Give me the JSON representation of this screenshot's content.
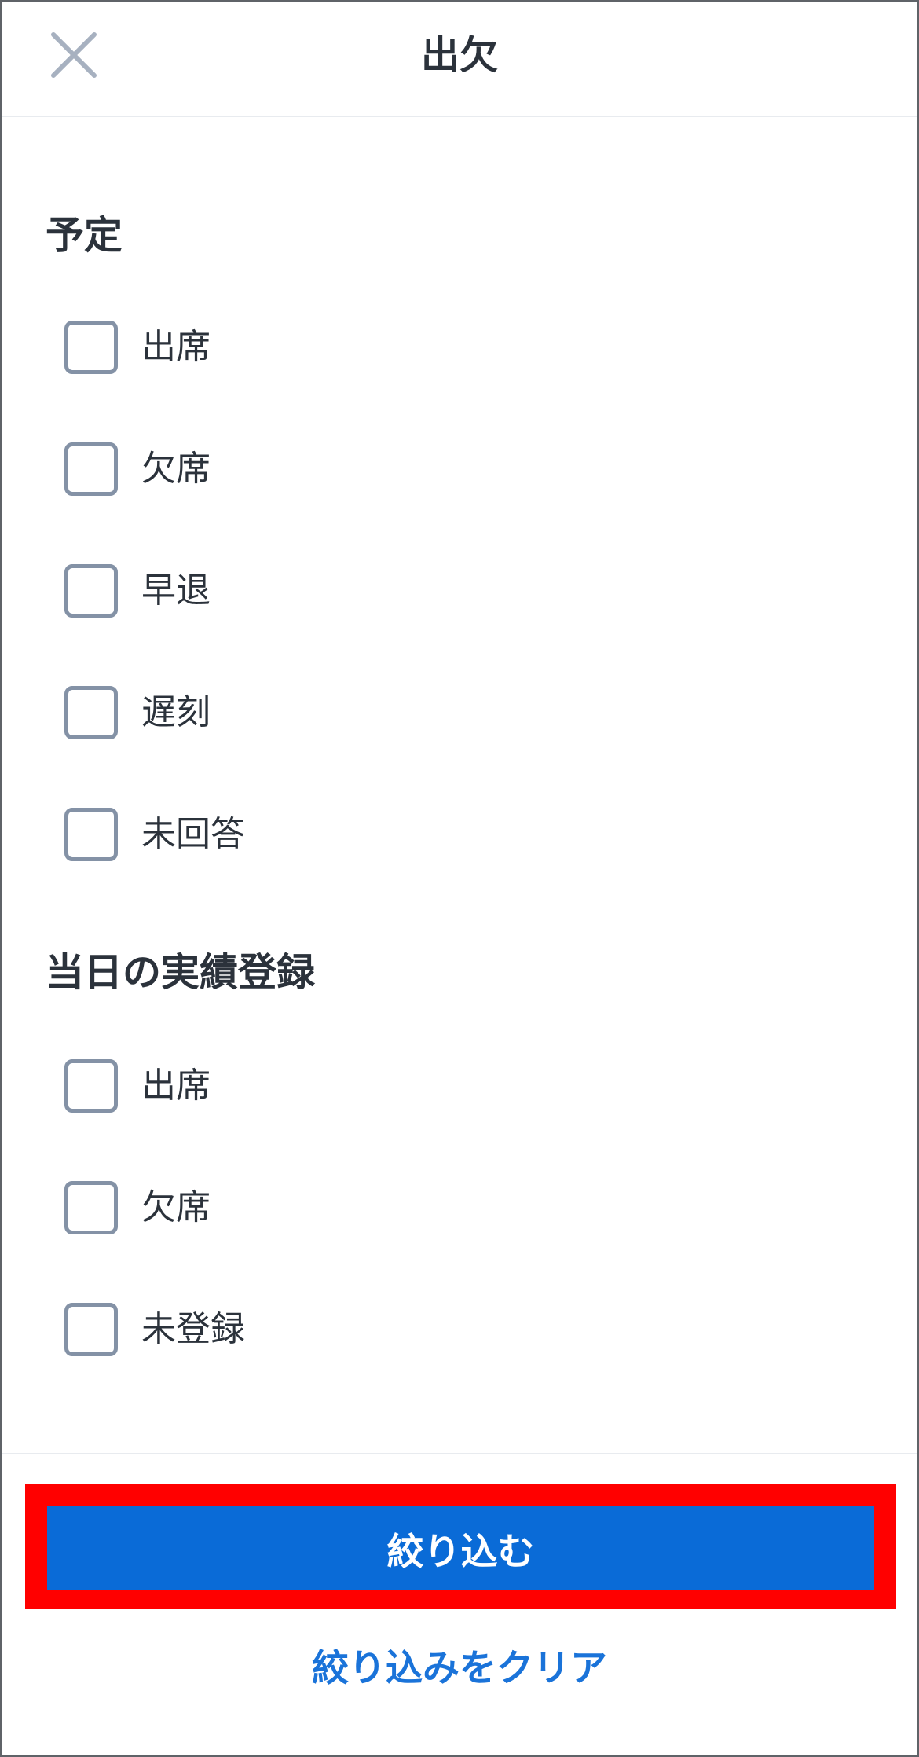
{
  "header": {
    "title": "出欠",
    "close_icon": "close-icon"
  },
  "sections": [
    {
      "title": "予定",
      "options": [
        {
          "label": "出席",
          "checked": false
        },
        {
          "label": "欠席",
          "checked": false
        },
        {
          "label": "早退",
          "checked": false
        },
        {
          "label": "遅刻",
          "checked": false
        },
        {
          "label": "未回答",
          "checked": false
        }
      ]
    },
    {
      "title": "当日の実績登録",
      "options": [
        {
          "label": "出席",
          "checked": false
        },
        {
          "label": "欠席",
          "checked": false
        },
        {
          "label": "未登録",
          "checked": false
        }
      ]
    }
  ],
  "footer": {
    "apply_label": "絞り込む",
    "clear_label": "絞り込みをクリア"
  },
  "colors": {
    "primary": "#0a6bd7",
    "link": "#1a73d9",
    "highlight": "#ff0000",
    "checkbox_border": "#8492a6",
    "text": "#2b323b"
  }
}
